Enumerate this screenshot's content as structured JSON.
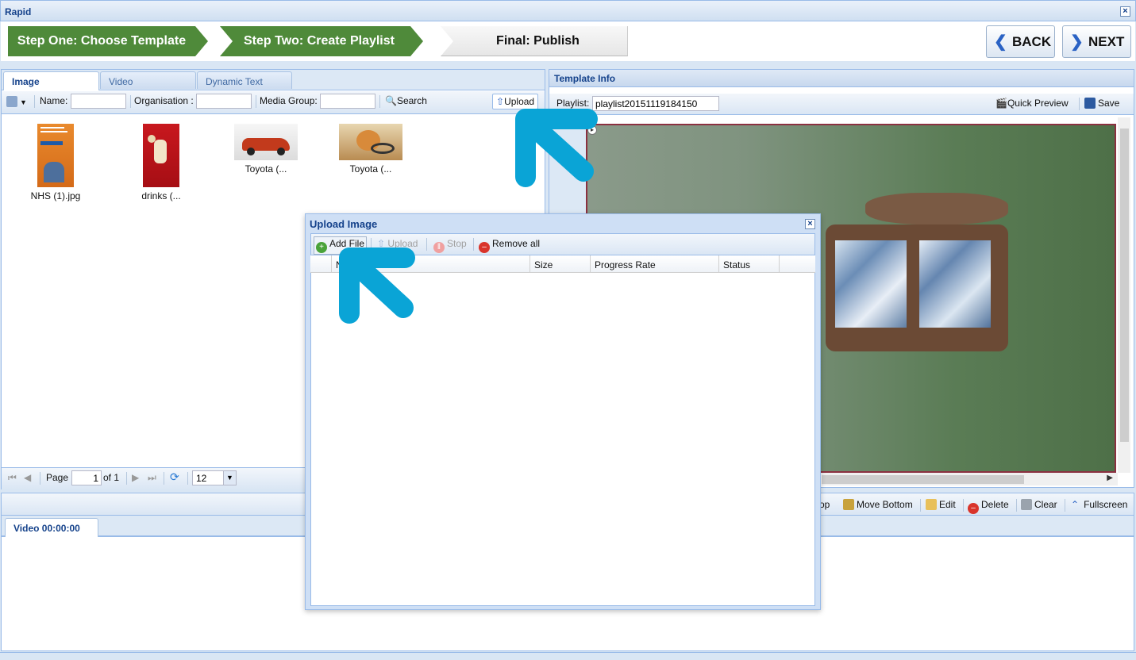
{
  "window": {
    "title": "Rapid"
  },
  "wizard": {
    "steps": [
      "Step One: Choose Template",
      "Step Two: Create Playlist",
      "Final: Publish"
    ],
    "back_label": "BACK",
    "next_label": "NEXT"
  },
  "media": {
    "tabs": [
      "Image",
      "Video",
      "Dynamic Text"
    ],
    "toolbar": {
      "name_label": "Name:",
      "org_label": "Organisation :",
      "group_label": "Media Group:",
      "search_label": "Search",
      "upload_label": "Upload"
    },
    "items": [
      {
        "caption": "NHS (1).jpg",
        "icon": "poster-thumbnail"
      },
      {
        "caption": "drinks (...",
        "icon": "poster-thumbnail"
      },
      {
        "caption": "Toyota (...",
        "icon": "car-thumbnail"
      },
      {
        "caption": "Toyota (...",
        "icon": "cat-thumbnail"
      }
    ],
    "pager": {
      "page_label": "Page",
      "page_value": "1",
      "of_label": "of 1",
      "page_size": "12"
    }
  },
  "template_info": {
    "header": "Template Info",
    "playlist_label": "Playlist:",
    "playlist_value": "playlist20151119184150",
    "quick_preview_label": "Quick Preview",
    "save_label": "Save"
  },
  "timeline": {
    "actions": [
      "op",
      "Move Bottom",
      "Edit",
      "Delete",
      "Clear",
      "Fullscreen"
    ],
    "tab_label": "Video 00:00:00"
  },
  "upload_dialog": {
    "title": "Upload Image",
    "toolbar": [
      "Add File",
      "Upload",
      "Stop",
      "Remove all"
    ],
    "columns": [
      "N",
      "Size",
      "Progress Rate",
      "Status"
    ]
  },
  "colors": {
    "step_done": "#4f8a3a",
    "accent_arrow": "#0aa4d6",
    "header_text": "#15428b"
  }
}
